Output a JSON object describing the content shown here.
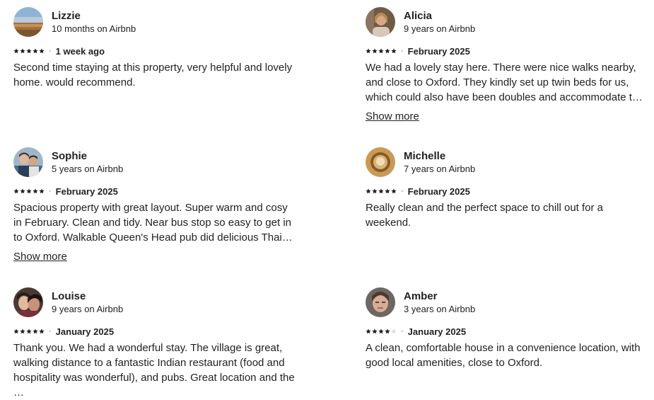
{
  "reviews": [
    {
      "name": "Lizzie",
      "tenure": "10 months on Airbnb",
      "rating": 5,
      "date": "1 week ago",
      "text": "Second time staying at this property, very helpful and lovely home. would recommend.",
      "avatar": "landscape-photo"
    },
    {
      "name": "Alicia",
      "tenure": "9 years on Airbnb",
      "rating": 5,
      "date": "February 2025",
      "text": "We had a lovely stay here. There were nice walks nearby, and close to Oxford. They kindly set up twin beds for us, which could also have been doubles and accommodate the toddle…",
      "show_more": "Show more",
      "avatar": "portrait-photo"
    },
    {
      "name": "Sophie",
      "tenure": "5 years on Airbnb",
      "rating": 5,
      "date": "February 2025",
      "text": "Spacious property with great layout. Super warm and cosy in February. Clean and tidy. Near bus stop so easy to get in to Oxford. Walkable Queen's Head pub did delicious Thai food. …",
      "show_more": "Show more",
      "avatar": "couple-photo"
    },
    {
      "name": "Michelle",
      "tenure": "7 years on Airbnb",
      "rating": 5,
      "date": "February 2025",
      "text": "Really clean and the perfect space to chill out for a weekend.",
      "avatar": "object-photo"
    },
    {
      "name": "Louise",
      "tenure": "9 years on Airbnb",
      "rating": 5,
      "date": "January 2025",
      "text": "Thank you. We had a wonderful stay. The village is great, walking distance to a fantastic Indian restaurant (food and hospitality was wonderful), and pubs. Great location and the …",
      "avatar": "selfie-photo"
    },
    {
      "name": "Amber",
      "tenure": "3 years on Airbnb",
      "rating": 4,
      "date": "January 2025",
      "text": "A clean, comfortable house in a convenience location, with good local amenities, close to Oxford.",
      "avatar": "face-photo"
    }
  ],
  "separator": "·"
}
